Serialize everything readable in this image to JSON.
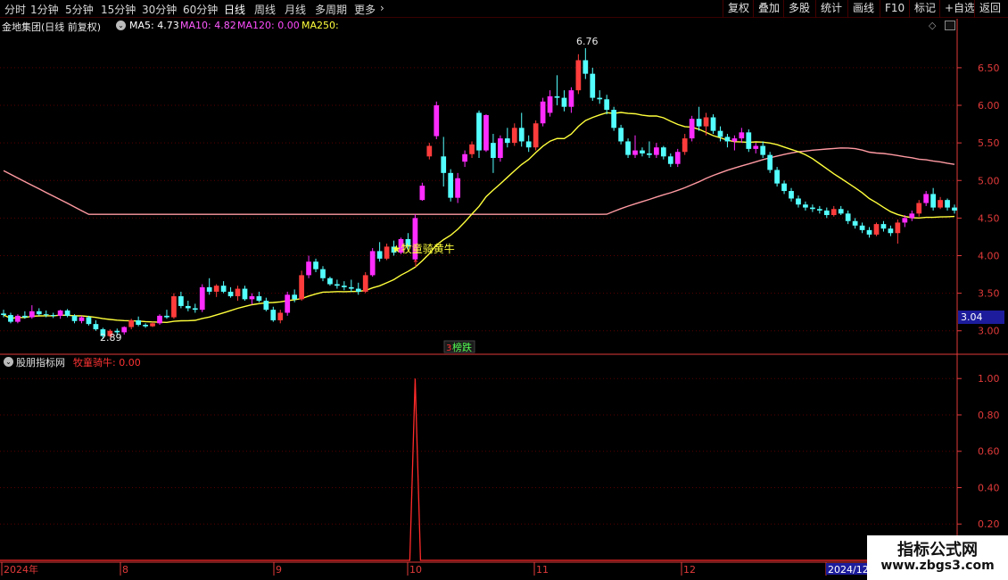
{
  "toolbar": {
    "periods": [
      "分时",
      "1分钟",
      "5分钟",
      "15分钟",
      "30分钟",
      "60分钟",
      "日线",
      "周线",
      "月线",
      "多周期",
      "更多"
    ],
    "active_period": "日线",
    "more_arrow": "›",
    "buttons": [
      "复权",
      "叠加",
      "多股",
      "统计",
      "画线",
      "F10",
      "标记",
      "+自选",
      "返回"
    ]
  },
  "main_info": {
    "stock": "金地集团(日线 前复权)",
    "toggle_icon": "circle-chevron-icon",
    "ma5": "MA5: 4.73",
    "ma10": "MA10: 4.82",
    "ma120": "MA120: 0.00",
    "ma250": "MA250:",
    "ma5_color": "#ffffff",
    "ma10_color": "#ff5cff",
    "ma120_color": "#ff4cff",
    "ma250_color": "#ffff3c"
  },
  "indicator_info": {
    "name": "股朋指标网",
    "line_label": "牧童骑牛: 0.00",
    "label_color": "#ff3333"
  },
  "current_price": "3.04",
  "annotations": {
    "high": "6.76",
    "low": "2.89",
    "signal": "★牧童骑黄牛",
    "event_badge": "3",
    "event_text": "榜跌"
  },
  "x_labels": [
    "2024年",
    "8",
    "9",
    "10",
    "11",
    "12",
    "2024/12"
  ],
  "watermark": {
    "title": "指标公式网",
    "url": "www.zbgs3.com"
  },
  "colors": {
    "up": "#ff3c3c",
    "up_alt": "#ff2cff",
    "down": "#54ffff",
    "ma_yellow": "#ffff3c",
    "ma_pink": "#ff9aa2",
    "grid": "#5a0000",
    "axis": "#e23a3a"
  },
  "chart_data": [
    {
      "type": "candlestick",
      "title": "金地集团(日线 前复权)",
      "y_ticks": [
        6.5,
        6.0,
        5.5,
        5.0,
        4.5,
        4.0,
        3.5,
        3.0
      ],
      "ylim": [
        2.7,
        6.95
      ],
      "grid": true,
      "candles": [
        [
          3.23,
          3.28,
          3.18,
          3.21
        ],
        [
          3.21,
          3.24,
          3.1,
          3.12
        ],
        [
          3.12,
          3.22,
          3.1,
          3.2
        ],
        [
          3.2,
          3.26,
          3.16,
          3.18
        ],
        [
          3.18,
          3.34,
          3.16,
          3.26
        ],
        [
          3.26,
          3.3,
          3.2,
          3.22
        ],
        [
          3.22,
          3.27,
          3.18,
          3.21
        ],
        [
          3.21,
          3.24,
          3.17,
          3.2
        ],
        [
          3.2,
          3.28,
          3.16,
          3.27
        ],
        [
          3.27,
          3.29,
          3.18,
          3.2
        ],
        [
          3.2,
          3.22,
          3.1,
          3.13
        ],
        [
          3.13,
          3.2,
          3.1,
          3.18
        ],
        [
          3.18,
          3.2,
          3.07,
          3.09
        ],
        [
          3.09,
          3.14,
          3.0,
          3.02
        ],
        [
          3.02,
          3.04,
          2.89,
          2.93
        ],
        [
          2.93,
          3.02,
          2.91,
          3.0
        ],
        [
          3.0,
          3.03,
          2.94,
          2.98
        ],
        [
          2.98,
          3.06,
          2.95,
          3.05
        ],
        [
          3.05,
          3.16,
          3.02,
          3.14
        ],
        [
          3.14,
          3.19,
          3.06,
          3.08
        ],
        [
          3.08,
          3.1,
          3.04,
          3.06
        ],
        [
          3.06,
          3.12,
          3.05,
          3.1
        ],
        [
          3.1,
          3.22,
          3.08,
          3.2
        ],
        [
          3.2,
          3.28,
          3.16,
          3.18
        ],
        [
          3.18,
          3.5,
          3.16,
          3.46
        ],
        [
          3.46,
          3.52,
          3.3,
          3.33
        ],
        [
          3.33,
          3.4,
          3.26,
          3.3
        ],
        [
          3.3,
          3.36,
          3.24,
          3.28
        ],
        [
          3.28,
          3.62,
          3.25,
          3.58
        ],
        [
          3.58,
          3.7,
          3.48,
          3.52
        ],
        [
          3.52,
          3.62,
          3.45,
          3.6
        ],
        [
          3.6,
          3.66,
          3.5,
          3.52
        ],
        [
          3.52,
          3.58,
          3.44,
          3.46
        ],
        [
          3.46,
          3.6,
          3.4,
          3.56
        ],
        [
          3.56,
          3.6,
          3.4,
          3.42
        ],
        [
          3.42,
          3.5,
          3.35,
          3.46
        ],
        [
          3.46,
          3.52,
          3.38,
          3.4
        ],
        [
          3.4,
          3.44,
          3.26,
          3.28
        ],
        [
          3.28,
          3.32,
          3.12,
          3.14
        ],
        [
          3.14,
          3.28,
          3.1,
          3.24
        ],
        [
          3.24,
          3.52,
          3.2,
          3.48
        ],
        [
          3.48,
          3.55,
          3.38,
          3.42
        ],
        [
          3.42,
          3.8,
          3.4,
          3.74
        ],
        [
          3.74,
          4.0,
          3.7,
          3.92
        ],
        [
          3.92,
          3.96,
          3.78,
          3.82
        ],
        [
          3.82,
          3.86,
          3.66,
          3.7
        ],
        [
          3.7,
          3.72,
          3.6,
          3.62
        ],
        [
          3.62,
          3.68,
          3.56,
          3.6
        ],
        [
          3.6,
          3.66,
          3.54,
          3.58
        ],
        [
          3.58,
          3.68,
          3.52,
          3.56
        ],
        [
          3.56,
          3.64,
          3.48,
          3.52
        ],
        [
          3.52,
          3.78,
          3.5,
          3.74
        ],
        [
          3.74,
          4.1,
          3.72,
          4.06
        ],
        [
          4.06,
          4.18,
          3.92,
          3.96
        ],
        [
          3.96,
          4.16,
          3.94,
          4.12
        ],
        [
          4.12,
          4.2,
          4.0,
          4.04
        ],
        [
          4.04,
          4.24,
          4.02,
          4.22
        ],
        [
          4.22,
          4.3,
          4.08,
          4.12
        ],
        [
          3.95,
          4.55,
          3.92,
          4.5
        ],
        [
          4.74,
          4.97,
          4.73,
          4.93
        ],
        [
          5.32,
          5.5,
          5.28,
          5.46
        ],
        [
          5.59,
          6.05,
          5.55,
          6.0
        ],
        [
          5.32,
          5.58,
          4.92,
          5.1
        ],
        [
          5.1,
          5.15,
          4.72,
          4.77
        ],
        [
          4.77,
          5.1,
          4.7,
          5.03
        ],
        [
          5.25,
          5.4,
          5.18,
          5.35
        ],
        [
          5.35,
          5.52,
          5.3,
          5.48
        ],
        [
          5.9,
          5.93,
          5.3,
          5.4
        ],
        [
          5.4,
          5.88,
          5.38,
          5.87
        ],
        [
          5.5,
          5.62,
          5.1,
          5.3
        ],
        [
          5.3,
          5.6,
          5.25,
          5.56
        ],
        [
          5.56,
          5.7,
          5.44,
          5.5
        ],
        [
          5.5,
          5.76,
          5.46,
          5.7
        ],
        [
          5.7,
          5.9,
          5.45,
          5.52
        ],
        [
          5.52,
          5.6,
          5.38,
          5.44
        ],
        [
          5.44,
          5.8,
          5.4,
          5.76
        ],
        [
          5.76,
          6.1,
          5.72,
          6.05
        ],
        [
          5.9,
          6.2,
          5.85,
          6.12
        ],
        [
          6.12,
          6.4,
          6.0,
          6.1
        ],
        [
          6.1,
          6.2,
          5.92,
          5.98
        ],
        [
          5.98,
          6.24,
          5.9,
          6.2
        ],
        [
          6.2,
          6.68,
          6.15,
          6.6
        ],
        [
          6.6,
          6.76,
          6.35,
          6.42
        ],
        [
          6.42,
          6.5,
          6.06,
          6.1
        ],
        [
          6.1,
          6.2,
          6.02,
          6.08
        ],
        [
          6.08,
          6.14,
          5.88,
          5.94
        ],
        [
          5.94,
          5.98,
          5.66,
          5.7
        ],
        [
          5.7,
          5.74,
          5.48,
          5.52
        ],
        [
          5.52,
          5.56,
          5.3,
          5.34
        ],
        [
          5.34,
          5.6,
          5.3,
          5.4
        ],
        [
          5.4,
          5.44,
          5.32,
          5.36
        ],
        [
          5.36,
          5.52,
          5.3,
          5.34
        ],
        [
          5.34,
          5.5,
          5.3,
          5.44
        ],
        [
          5.44,
          5.46,
          5.28,
          5.32
        ],
        [
          5.32,
          5.36,
          5.18,
          5.22
        ],
        [
          5.22,
          5.42,
          5.18,
          5.38
        ],
        [
          5.38,
          5.62,
          5.34,
          5.56
        ],
        [
          5.56,
          5.86,
          5.52,
          5.82
        ],
        [
          5.82,
          5.98,
          5.66,
          5.72
        ],
        [
          5.72,
          5.9,
          5.6,
          5.84
        ],
        [
          5.84,
          5.88,
          5.62,
          5.66
        ],
        [
          5.66,
          5.72,
          5.52,
          5.58
        ],
        [
          5.58,
          5.62,
          5.44,
          5.52
        ],
        [
          5.52,
          5.6,
          5.4,
          5.56
        ],
        [
          5.56,
          5.7,
          5.5,
          5.64
        ],
        [
          5.64,
          5.68,
          5.38,
          5.42
        ],
        [
          5.42,
          5.5,
          5.36,
          5.46
        ],
        [
          5.46,
          5.52,
          5.3,
          5.34
        ],
        [
          5.34,
          5.38,
          5.1,
          5.14
        ],
        [
          5.14,
          5.18,
          4.92,
          4.96
        ],
        [
          4.96,
          5.0,
          4.82,
          4.86
        ],
        [
          4.86,
          4.9,
          4.72,
          4.76
        ],
        [
          4.76,
          4.8,
          4.64,
          4.68
        ],
        [
          4.68,
          4.72,
          4.6,
          4.64
        ],
        [
          4.64,
          4.68,
          4.58,
          4.62
        ],
        [
          4.62,
          4.66,
          4.56,
          4.6
        ],
        [
          4.6,
          4.64,
          4.5,
          4.54
        ],
        [
          4.54,
          4.66,
          4.52,
          4.62
        ],
        [
          4.62,
          4.66,
          4.54,
          4.56
        ],
        [
          4.56,
          4.6,
          4.42,
          4.46
        ],
        [
          4.46,
          4.5,
          4.36,
          4.4
        ],
        [
          4.4,
          4.44,
          4.3,
          4.34
        ],
        [
          4.34,
          4.38,
          4.24,
          4.28
        ],
        [
          4.28,
          4.44,
          4.26,
          4.42
        ],
        [
          4.42,
          4.46,
          4.32,
          4.36
        ],
        [
          4.36,
          4.4,
          4.26,
          4.3
        ],
        [
          4.3,
          4.48,
          4.16,
          4.44
        ],
        [
          4.44,
          4.54,
          4.38,
          4.5
        ],
        [
          4.5,
          4.6,
          4.46,
          4.56
        ],
        [
          4.56,
          4.74,
          4.52,
          4.7
        ],
        [
          4.7,
          4.86,
          4.66,
          4.82
        ],
        [
          4.82,
          4.9,
          4.6,
          4.64
        ],
        [
          4.64,
          4.78,
          4.62,
          4.74
        ],
        [
          4.74,
          4.76,
          4.6,
          4.64
        ],
        [
          4.64,
          4.68,
          4.56,
          4.6
        ]
      ],
      "series": [
        {
          "name": "MA5",
          "values": []
        },
        {
          "name": "MA10",
          "values": []
        }
      ]
    },
    {
      "type": "line",
      "series": [
        {
          "name": "牧童骑牛",
          "values": [
            0.0,
            1.0,
            0.0
          ]
        }
      ],
      "y_ticks": [
        1.0,
        0.8,
        0.6,
        0.4,
        0.2
      ],
      "ylim": [
        0,
        1.06
      ],
      "grid": true
    }
  ]
}
